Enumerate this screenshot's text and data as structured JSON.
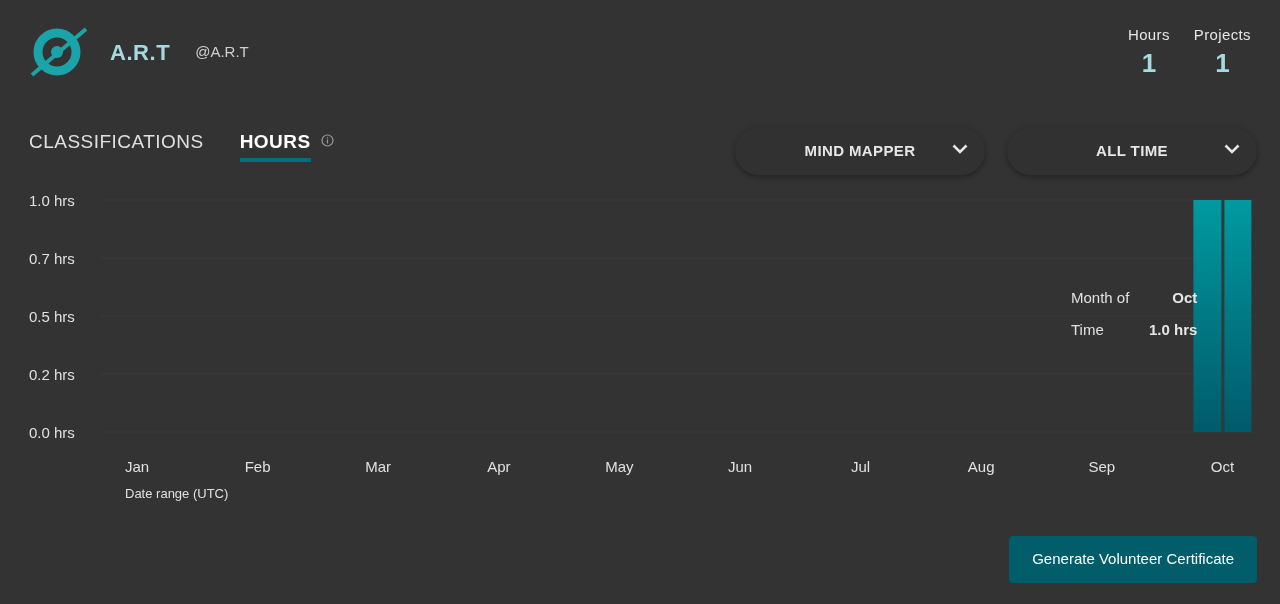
{
  "profile": {
    "name": "A.R.T",
    "handle": "@A.R.T"
  },
  "stats": [
    {
      "label": "Hours",
      "value": "1"
    },
    {
      "label": "Projects",
      "value": "1"
    }
  ],
  "tabs": [
    {
      "label": "CLASSIFICATIONS",
      "selected": false
    },
    {
      "label": "HOURS",
      "selected": true
    }
  ],
  "dropdowns": [
    {
      "value": "MIND MAPPER"
    },
    {
      "value": "ALL TIME"
    }
  ],
  "chart": {
    "chart_data": {
      "type": "bar",
      "xlabel": "Date range (UTC)",
      "categories": [
        "Jan",
        "Feb",
        "Mar",
        "Apr",
        "May",
        "Jun",
        "Jul",
        "Aug",
        "Sep",
        "Oct"
      ],
      "values": [
        0,
        0,
        0,
        0,
        0,
        0,
        0,
        0,
        0,
        1.0
      ],
      "ylim": [
        0,
        1
      ],
      "yticks": [
        {
          "value": 0,
          "label": "0.0 hrs"
        },
        {
          "value": 0.25,
          "label": "0.2 hrs"
        },
        {
          "value": 0.5,
          "label": "0.5 hrs"
        },
        {
          "value": 0.75,
          "label": "0.7 hrs"
        },
        {
          "value": 1,
          "label": "1.0 hrs"
        }
      ]
    },
    "tooltip": [
      {
        "label": "Month of",
        "value": "Oct"
      },
      {
        "label": "Time",
        "value": "1.0 hrs"
      }
    ]
  },
  "certificate_button": "Generate Volunteer Certificate"
}
